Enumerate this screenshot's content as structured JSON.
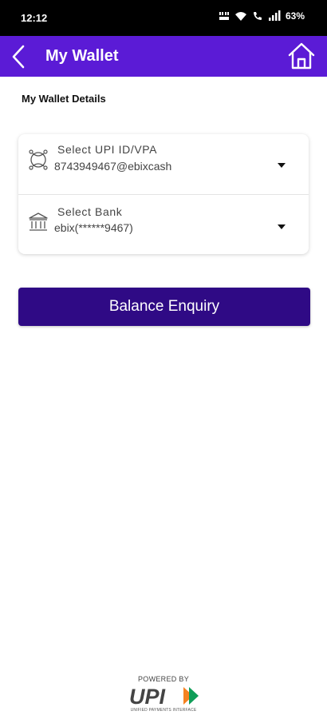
{
  "status_bar": {
    "time": "12:12",
    "battery": "63%",
    "icons": [
      "data-speed-icon",
      "wifi-icon",
      "wifi-calling-icon",
      "signal-icon"
    ]
  },
  "app_bar": {
    "title": "My Wallet",
    "back_icon": "chevron-left-icon",
    "home_icon": "home-icon",
    "background": "#5b1bd6"
  },
  "wallet_details": {
    "heading": "My Wallet Details",
    "upi_field": {
      "label": "Select UPI ID/VPA",
      "value": "8743949467@ebixcash",
      "icon": "upi-id-icon"
    },
    "bank_field": {
      "label": "Select Bank",
      "value": "ebix(******9467)",
      "icon": "bank-icon"
    }
  },
  "actions": {
    "balance_enquiry_label": "Balance Enquiry",
    "button_color": "#2f0a85"
  },
  "footer": {
    "powered_by": "POWERED BY",
    "logo_text": "UPI",
    "logo_subtext": "UNIFIED PAYMENTS INTERFACE"
  }
}
